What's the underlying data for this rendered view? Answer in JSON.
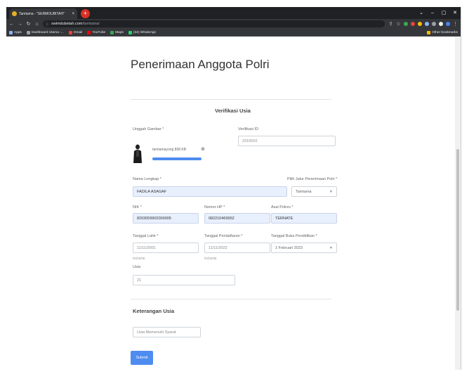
{
  "browser": {
    "tab_title": "Tamtama - \"SERMOUBITAH\"",
    "tab_close": "×",
    "new_tab": "+",
    "url_host": "swimdubetah.com",
    "url_path": "/tamtama/",
    "window_controls": [
      "⌄",
      "–",
      "▢",
      "✕"
    ],
    "bookmarks": [
      {
        "label": "Apps",
        "color": "#8ab4f8"
      },
      {
        "label": "Dashboard Utama -...",
        "color": "#9aa0a6"
      },
      {
        "label": "Gmail",
        "color": "#ea4335"
      },
      {
        "label": "YouTube",
        "color": "#ff0000"
      },
      {
        "label": "Maps",
        "color": "#34a853"
      },
      {
        "label": "(34) WhatsApp",
        "color": "#25d366"
      }
    ],
    "other_bookmarks": "Other bookmarks"
  },
  "page": {
    "title": "Penerimaan Anggota Polri",
    "section1_title": "Verifikasi Usia",
    "upload_label": "Unggah Gambar *",
    "file_name": "tamtamayong 808 KB",
    "upload_progress": 1.0,
    "verif_id_label": "Verifikasi ID",
    "verif_id_value": "2310010",
    "nama_label": "Nama Lengkap *",
    "nama_value": "FADILA ASAGAF",
    "jalur_label": "Pilih Jalur Penerimaan Polri *",
    "jalur_value": "Tamtama",
    "nik_label": "NIK *",
    "nik_value": "8203059902000005",
    "hp_label": "Nomor HP *",
    "hp_value": "082210469952",
    "polres_label": "Asal Polres *",
    "polres_value": "TERNATE",
    "lahir_label": "Tanggal Lahir *",
    "lahir_value": "11/11/2001",
    "lahir_hint": "hh/bb/tttt",
    "daftar_label": "Tanggal Pendaftaran *",
    "daftar_value": "11/11/2022",
    "daftar_hint": "hh/bb/tttt",
    "buka_label": "Tanggal Buka Pendidikan *",
    "buka_value": "1 Februari 2023",
    "usia_label": "Usia",
    "usia_value": "21",
    "section2_title": "Keterangan Usia",
    "ket_placeholder": "Usia Memenuhi Syarat",
    "submit_label": "Submit"
  }
}
